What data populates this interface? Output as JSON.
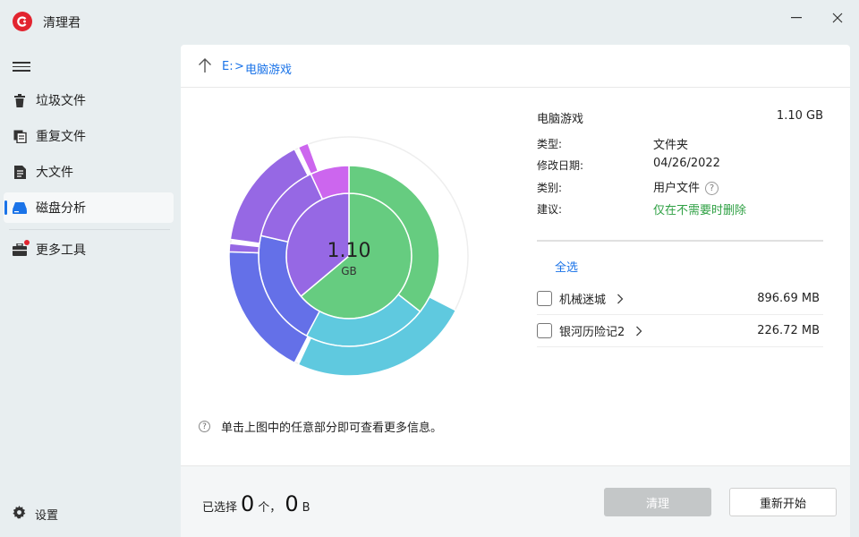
{
  "app": {
    "title": "清理君",
    "logo_icon": "app-logo-icon"
  },
  "window": {
    "minimize_icon": "minimize-icon",
    "close_icon": "close-icon"
  },
  "sidebar": {
    "menu_icon": "hamburger-icon",
    "items": [
      {
        "label": "垃圾文件",
        "icon": "trash-icon",
        "active": false
      },
      {
        "label": "重复文件",
        "icon": "duplicate-icon",
        "active": false
      },
      {
        "label": "大文件",
        "icon": "large-file-icon",
        "active": false
      },
      {
        "label": "磁盘分析",
        "icon": "disk-icon",
        "active": true
      },
      {
        "label": "更多工具",
        "icon": "toolbox-icon",
        "active": false,
        "badge": "red-dot"
      }
    ],
    "settings_label": "设置"
  },
  "breadcrumb": {
    "drive": "E:",
    "separator": ">",
    "folder": "电脑游戏"
  },
  "chart": {
    "center_value": "1.10",
    "center_unit": "GB",
    "colors": {
      "green": "#66cc80",
      "cyan": "#5fc9df",
      "blue": "#6470e8",
      "purple": "#9668e4",
      "magenta": "#cc66ee"
    }
  },
  "hint": "单击上图中的任意部分即可查看更多信息。",
  "info": {
    "name": "电脑游戏",
    "size": "1.10 GB",
    "rows": [
      {
        "label": "类型:",
        "value": "文件夹"
      },
      {
        "label": "修改日期:",
        "value": "04/26/2022"
      },
      {
        "label": "类别:",
        "value": "用户文件"
      },
      {
        "label": "建议:",
        "value": "仅在不需要时删除"
      }
    ]
  },
  "select_all": "全选",
  "files": [
    {
      "name": "机械迷城",
      "size": "896.69 MB"
    },
    {
      "name": "银河历险记2",
      "size": "226.72 MB"
    }
  ],
  "footer": {
    "selected_prefix": "已选择",
    "count": "0",
    "count_unit": "个，",
    "size": "0",
    "size_unit": "B",
    "clean_button": "清理",
    "restart_button": "重新开始"
  }
}
